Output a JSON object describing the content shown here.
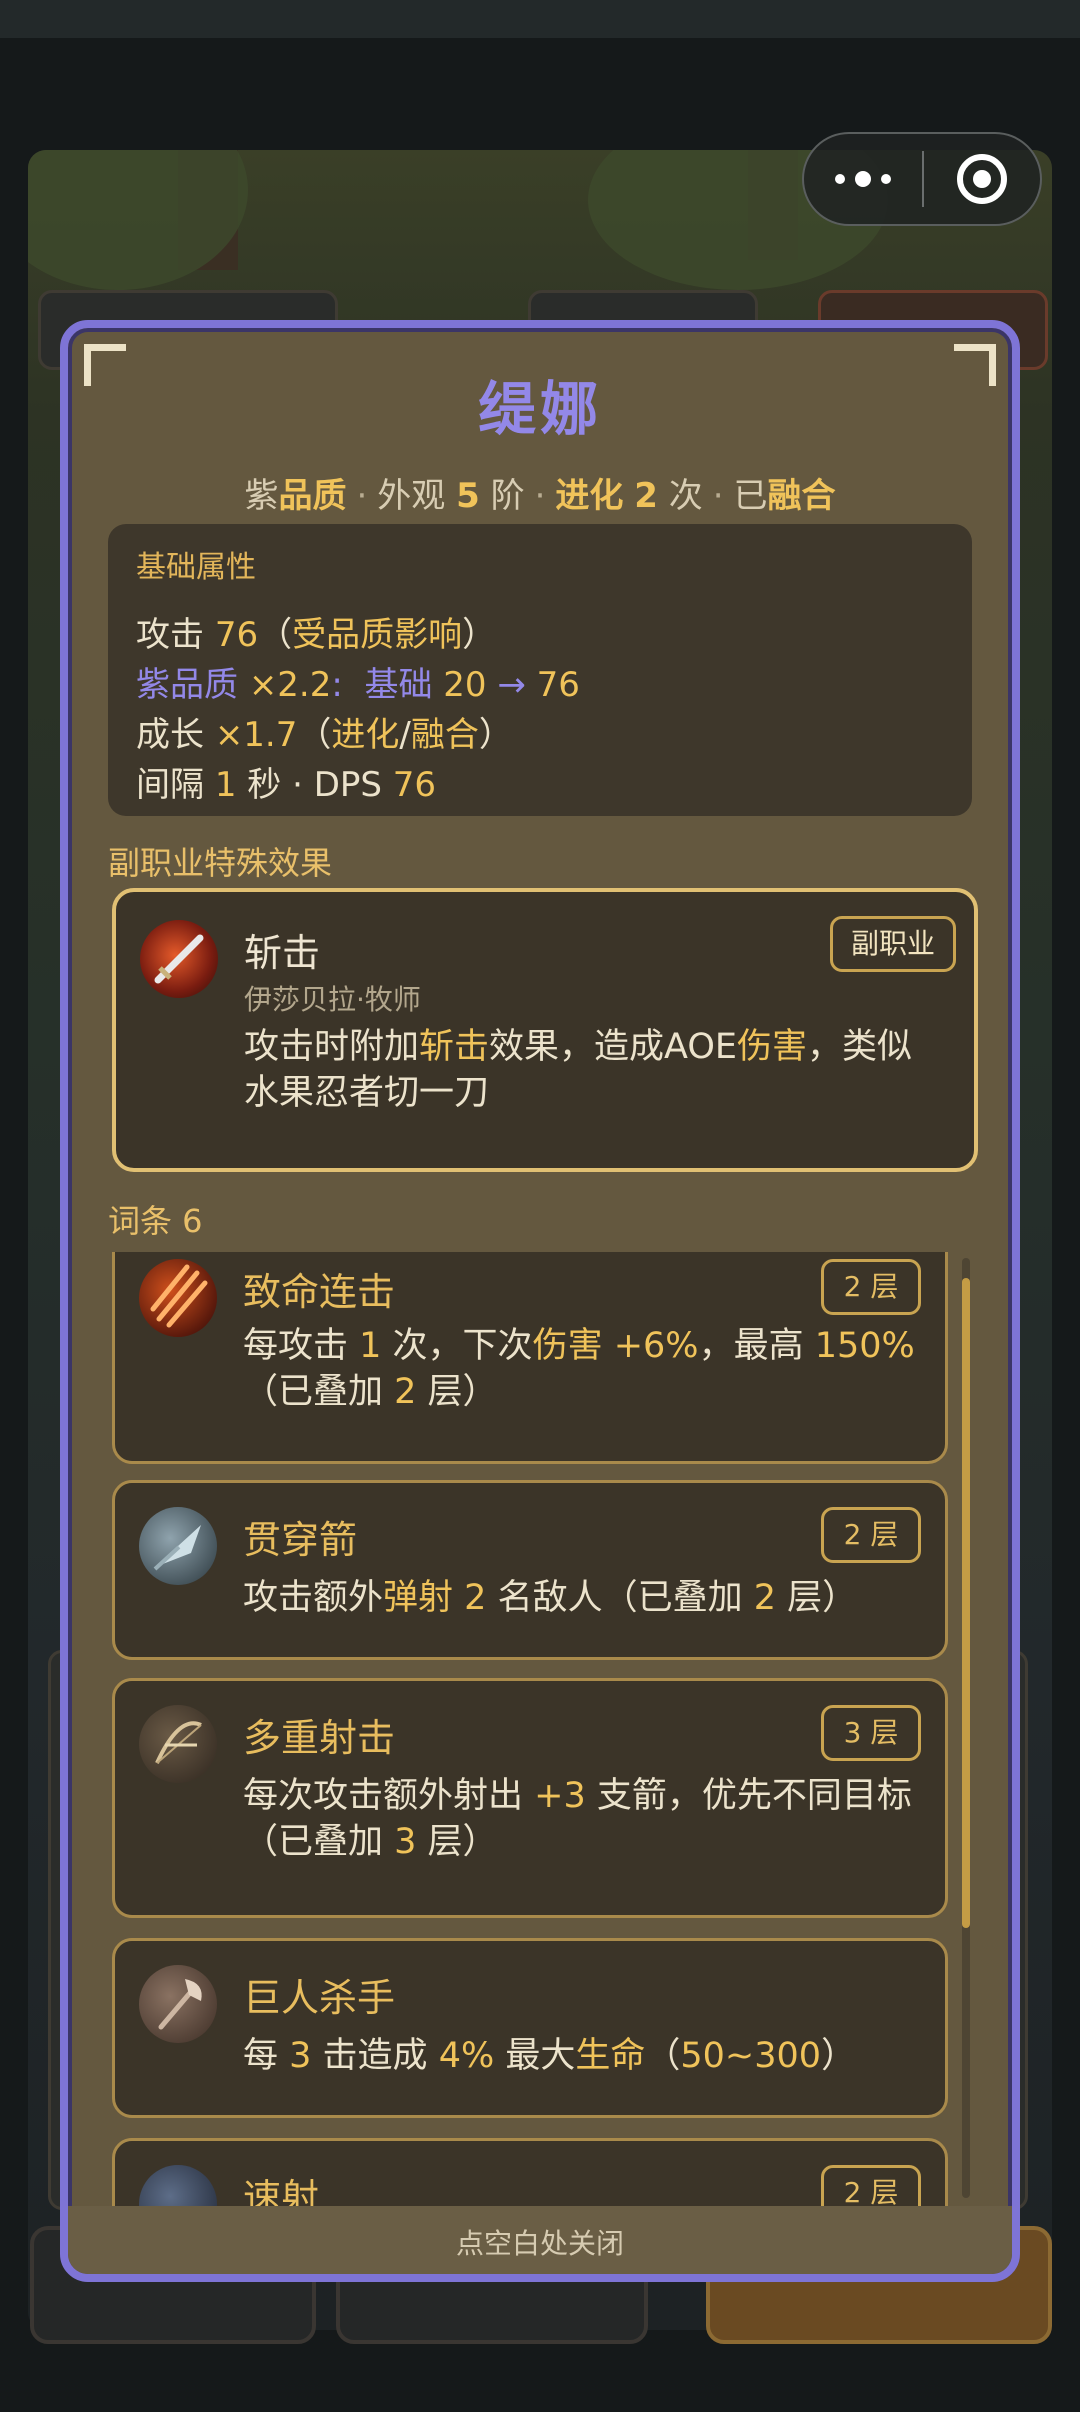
{
  "capsule": {
    "more_icon": "more-dots-icon",
    "close_icon": "target-close-icon"
  },
  "hero": {
    "name": "缇娜",
    "subline": {
      "quality_color": "紫",
      "quality_word": "品质",
      "appearance_label": "外观",
      "appearance_level": "5",
      "appearance_unit": "阶",
      "evolve_label": "进化",
      "evolve_count": "2",
      "evolve_unit": "次",
      "fused_prefix": "已",
      "fused_word": "融合",
      "separator": "·"
    }
  },
  "base_stats": {
    "header": "基础属性",
    "attack_label": "攻击",
    "attack_value": "76",
    "attack_note_open": "（",
    "attack_note": "受品质影响",
    "attack_note_close": "）",
    "quality_mult_label": "紫品质",
    "quality_mult_value": "×2.2",
    "quality_mult_colon": ":",
    "quality_base_label": "基础",
    "quality_base_from": "20",
    "quality_arrow": "→",
    "quality_base_to": "76",
    "growth_label": "成长",
    "growth_value": "×1.7",
    "growth_note_open": "（",
    "growth_note_a": "进化",
    "growth_note_slash": "/",
    "growth_note_b": "融合",
    "growth_note_close": "）",
    "interval_label": "间隔",
    "interval_value": "1",
    "interval_unit": "秒",
    "dps_sep": "·",
    "dps_label": "DPS",
    "dps_value": "76"
  },
  "sub_class": {
    "section_title": "副职业特殊效果",
    "skill_name": "斩击",
    "skill_icon": "slash-sword-icon",
    "source": "伊莎贝拉·牧师",
    "tag": "副职业",
    "desc_a": "攻击时附加",
    "desc_b": "斩击",
    "desc_c": "效果，造成AOE",
    "desc_d": "伤害",
    "desc_e": "，类似水果忍者切一刀"
  },
  "affixes": {
    "section_title": "词条 6",
    "items": [
      {
        "name": "致命连击",
        "icon": "claw-slash-icon",
        "tag": "2 层",
        "desc_a": "每攻击 ",
        "v1": "1",
        "desc_b": " 次，下次",
        "kw": "伤害",
        "v2": " +6%",
        "desc_c": "，最高 ",
        "v3": "150%",
        "line2_a": "（已叠加 ",
        "line2_v": "2",
        "line2_b": " 层）"
      },
      {
        "name": "贯穿箭",
        "icon": "piercing-arrow-icon",
        "tag": "2 层",
        "desc_a": "攻击额外",
        "kw": "弹射",
        "v1": " 2",
        "desc_b": " 名敌人（已叠加 ",
        "v2": "2",
        "desc_c": " 层）"
      },
      {
        "name": "多重射击",
        "icon": "multishot-bow-icon",
        "tag": "3 层",
        "desc_a": "每次攻击额外射出 ",
        "v1": "+3",
        "desc_b": " 支箭，优先不同目标",
        "line2_a": "（已叠加 ",
        "line2_v": "3",
        "line2_b": " 层）"
      },
      {
        "name": "巨人杀手",
        "icon": "giant-axe-icon",
        "desc_a": "每 ",
        "v1": "3",
        "desc_b": " 击造成 ",
        "v2": "4%",
        "desc_c": " 最大",
        "kw": "生命",
        "desc_d": "（",
        "v3": "50~300",
        "desc_e": "）"
      },
      {
        "name": "速射",
        "icon": "rapid-fire-icon",
        "tag": "2 层"
      }
    ]
  },
  "close_hint": "点空白处关闭",
  "colors": {
    "accent_purple": "#9388e8",
    "gold": "#f0c35a",
    "modal_bg": "#64583f",
    "border": "#7e74d6"
  }
}
